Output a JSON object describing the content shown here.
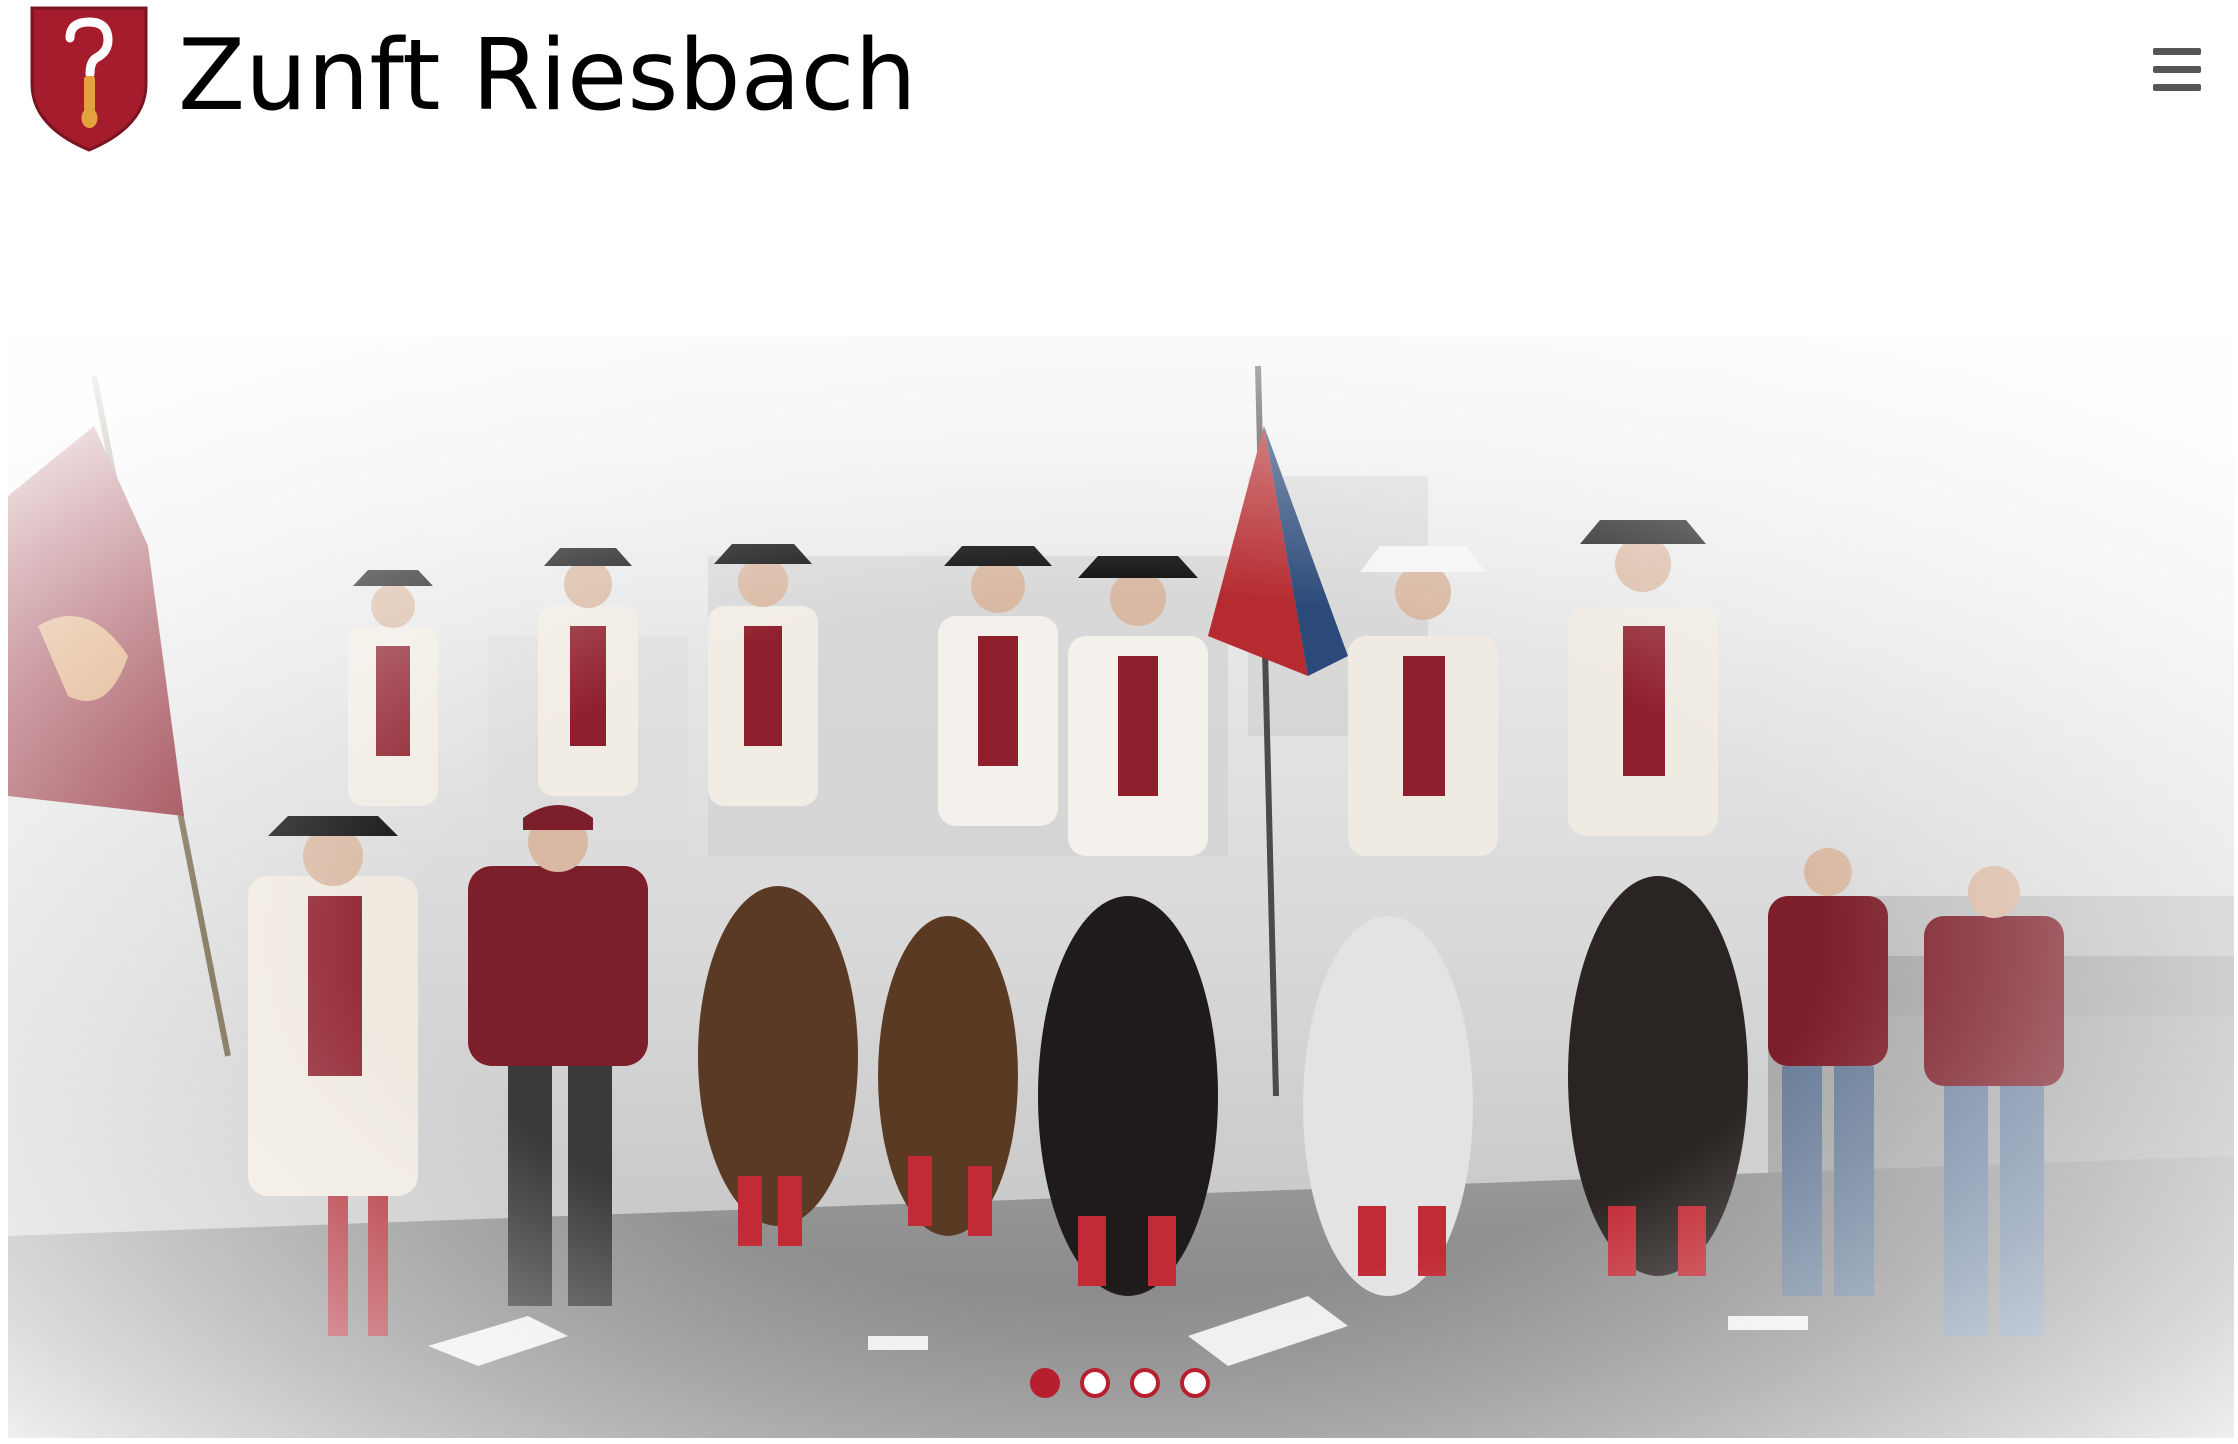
{
  "header": {
    "site_title": "Zunft Riesbach",
    "menu_icon": "hamburger-menu-icon"
  },
  "brand": {
    "accent": "#b81f2e",
    "crest_red": "#a51d2d",
    "crest_gold": "#e2a23c"
  },
  "hero": {
    "slides_total": 4,
    "active_slide": 1
  }
}
